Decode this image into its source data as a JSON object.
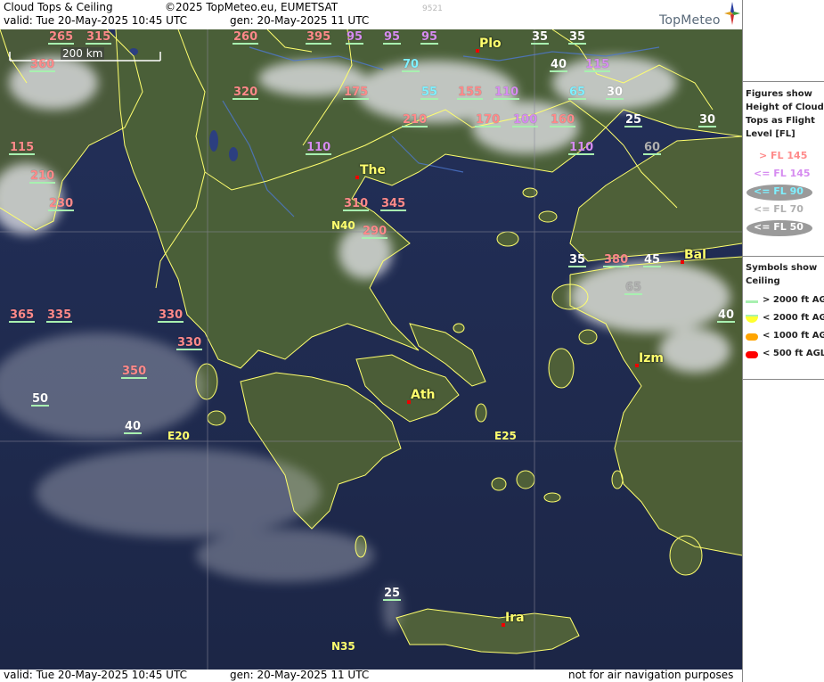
{
  "header": {
    "title": "Cloud Tops & Ceiling",
    "copyright": "©2025 TopMeteo.eu, EUMETSAT",
    "valid": "valid:  Tue  20-May-2025  10:45 UTC",
    "gen": "gen: 20-May-2025 11 UTC",
    "code": "9521",
    "logo": "TopMeteo"
  },
  "footer": {
    "valid": "valid:  Tue  20-May-2025  10:45 UTC",
    "gen": "gen: 20-May-2025 11 UTC",
    "disclaimer": "not for air navigation purposes"
  },
  "scale": {
    "label": "200 km"
  },
  "legend": {
    "figures_title": [
      "Figures show",
      "Height of Cloud",
      "Tops as Flight",
      "Level  [FL]"
    ],
    "levels": [
      {
        "label": "> FL 145",
        "color": "#ff8a8a",
        "ellipse": false
      },
      {
        "label": "<= FL 145",
        "color": "#d68cf0",
        "ellipse": false
      },
      {
        "label": "<= FL 90",
        "color": "#7ff0ff",
        "ellipse": true
      },
      {
        "label": "<= FL 70",
        "color": "#b0b0b0",
        "ellipse": false
      },
      {
        "label": "<= FL 50",
        "color": "#ffffff",
        "ellipse": true
      }
    ],
    "symbols_title": [
      "Symbols show",
      "Ceiling"
    ],
    "symbols": [
      {
        "label": "> 2000 ft AGL",
        "color": "#a8f0b0",
        "shape": "line"
      },
      {
        "label": "< 2000 ft AGL",
        "color": "#ffff30",
        "shape": "half"
      },
      {
        "label": "< 1000 ft AGL",
        "color": "#ffa500",
        "shape": "pill"
      },
      {
        "label": "< 500 ft AGL",
        "color": "#ff0000",
        "shape": "pill"
      }
    ]
  },
  "colors": {
    "gt145": "#ff8a8a",
    "le145": "#d68cf0",
    "le90": "#7ff0ff",
    "le70": "#b0b0b0",
    "le50": "#ffffff",
    "ceiling_ok": "#a8f0b0",
    "border": "#ffff6e",
    "sea": "#1f2a4d"
  },
  "cities": [
    {
      "name": "Plo"
    },
    {
      "name": "The"
    },
    {
      "name": "Bal"
    },
    {
      "name": "Izm"
    },
    {
      "name": "Ath"
    },
    {
      "name": "Ira"
    }
  ],
  "grid_labels": [
    "N40",
    "E20",
    "E25",
    "N35"
  ],
  "cloud_values": [
    {
      "v": "265",
      "c": "gt145"
    },
    {
      "v": "315",
      "c": "gt145"
    },
    {
      "v": "260",
      "c": "gt145"
    },
    {
      "v": "395",
      "c": "gt145"
    },
    {
      "v": "95",
      "c": "le145"
    },
    {
      "v": "95",
      "c": "le145"
    },
    {
      "v": "95",
      "c": "le145"
    },
    {
      "v": "35",
      "c": "le50"
    },
    {
      "v": "35",
      "c": "le50"
    },
    {
      "v": "360",
      "c": "gt145"
    },
    {
      "v": "70",
      "c": "le90"
    },
    {
      "v": "40",
      "c": "le50"
    },
    {
      "v": "115",
      "c": "le145"
    },
    {
      "v": "320",
      "c": "gt145"
    },
    {
      "v": "175",
      "c": "gt145"
    },
    {
      "v": "55",
      "c": "le90"
    },
    {
      "v": "155",
      "c": "gt145"
    },
    {
      "v": "110",
      "c": "le145"
    },
    {
      "v": "65",
      "c": "le90"
    },
    {
      "v": "30",
      "c": "le50"
    },
    {
      "v": "210",
      "c": "gt145"
    },
    {
      "v": "170",
      "c": "gt145"
    },
    {
      "v": "100",
      "c": "le145"
    },
    {
      "v": "160",
      "c": "gt145"
    },
    {
      "v": "25",
      "c": "le50"
    },
    {
      "v": "30",
      "c": "le50"
    },
    {
      "v": "115",
      "c": "gt145"
    },
    {
      "v": "110",
      "c": "le145"
    },
    {
      "v": "110",
      "c": "le145"
    },
    {
      "v": "60",
      "c": "le70"
    },
    {
      "v": "210",
      "c": "gt145"
    },
    {
      "v": "230",
      "c": "gt145"
    },
    {
      "v": "310",
      "c": "gt145"
    },
    {
      "v": "345",
      "c": "gt145"
    },
    {
      "v": "290",
      "c": "gt145"
    },
    {
      "v": "35",
      "c": "le50"
    },
    {
      "v": "380",
      "c": "gt145"
    },
    {
      "v": "45",
      "c": "le50"
    },
    {
      "v": "65",
      "c": "le70"
    },
    {
      "v": "365",
      "c": "gt145"
    },
    {
      "v": "335",
      "c": "gt145"
    },
    {
      "v": "330",
      "c": "gt145"
    },
    {
      "v": "40",
      "c": "le50"
    },
    {
      "v": "330",
      "c": "gt145"
    },
    {
      "v": "350",
      "c": "gt145"
    },
    {
      "v": "50",
      "c": "le50"
    },
    {
      "v": "40",
      "c": "le50"
    },
    {
      "v": "25",
      "c": "le50"
    }
  ]
}
